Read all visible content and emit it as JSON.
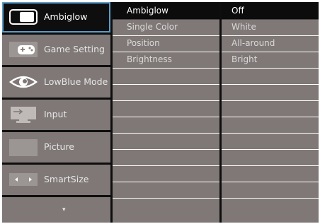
{
  "menu": {
    "items": [
      {
        "label": "Ambiglow",
        "icon": "ambiglow-icon"
      },
      {
        "label": "Game Setting",
        "icon": "gamepad-icon"
      },
      {
        "label": "LowBlue Mode",
        "icon": "eye-icon"
      },
      {
        "label": "Input",
        "icon": "input-icon"
      },
      {
        "label": "Picture",
        "icon": "picture-icon"
      },
      {
        "label": "SmartSize",
        "icon": "smartsize-icon"
      }
    ],
    "more_arrow": "▾"
  },
  "submenu": {
    "items": [
      "Ambiglow",
      "Single Color",
      "Position",
      "Brightness"
    ]
  },
  "options": {
    "items": [
      "Off",
      "White",
      "All-around",
      "Bright"
    ]
  },
  "colors": {
    "panel": "#0e0e0e",
    "item_bg": "#7f7876",
    "selection_border": "#5a9ec7"
  }
}
